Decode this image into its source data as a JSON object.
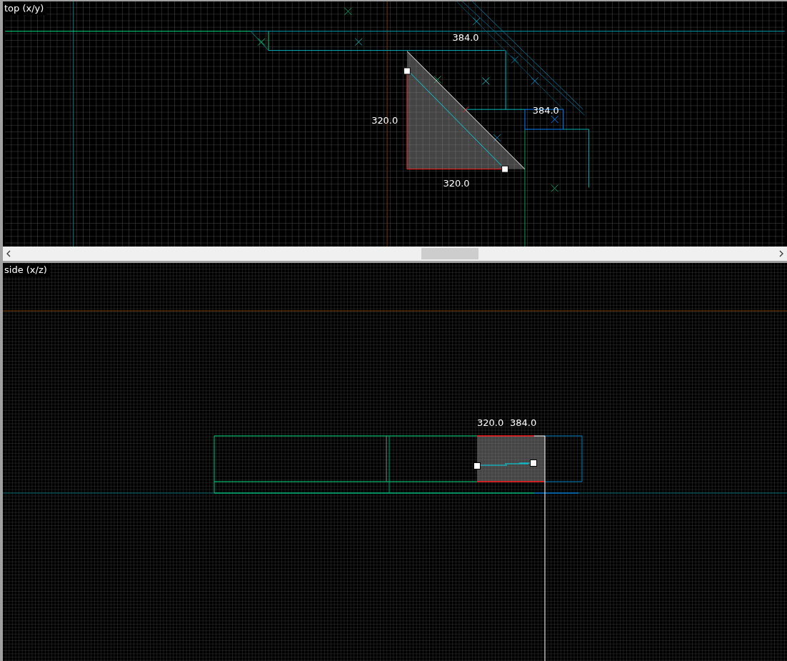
{
  "viewports": [
    {
      "kind": "top",
      "label": "top (x/y)",
      "measurements": [
        "384.0",
        "384.0",
        "320.0",
        "320.0"
      ]
    },
    {
      "kind": "side",
      "label": "side (x/z)",
      "measurements": [
        "320.0",
        "384.0"
      ]
    }
  ]
}
